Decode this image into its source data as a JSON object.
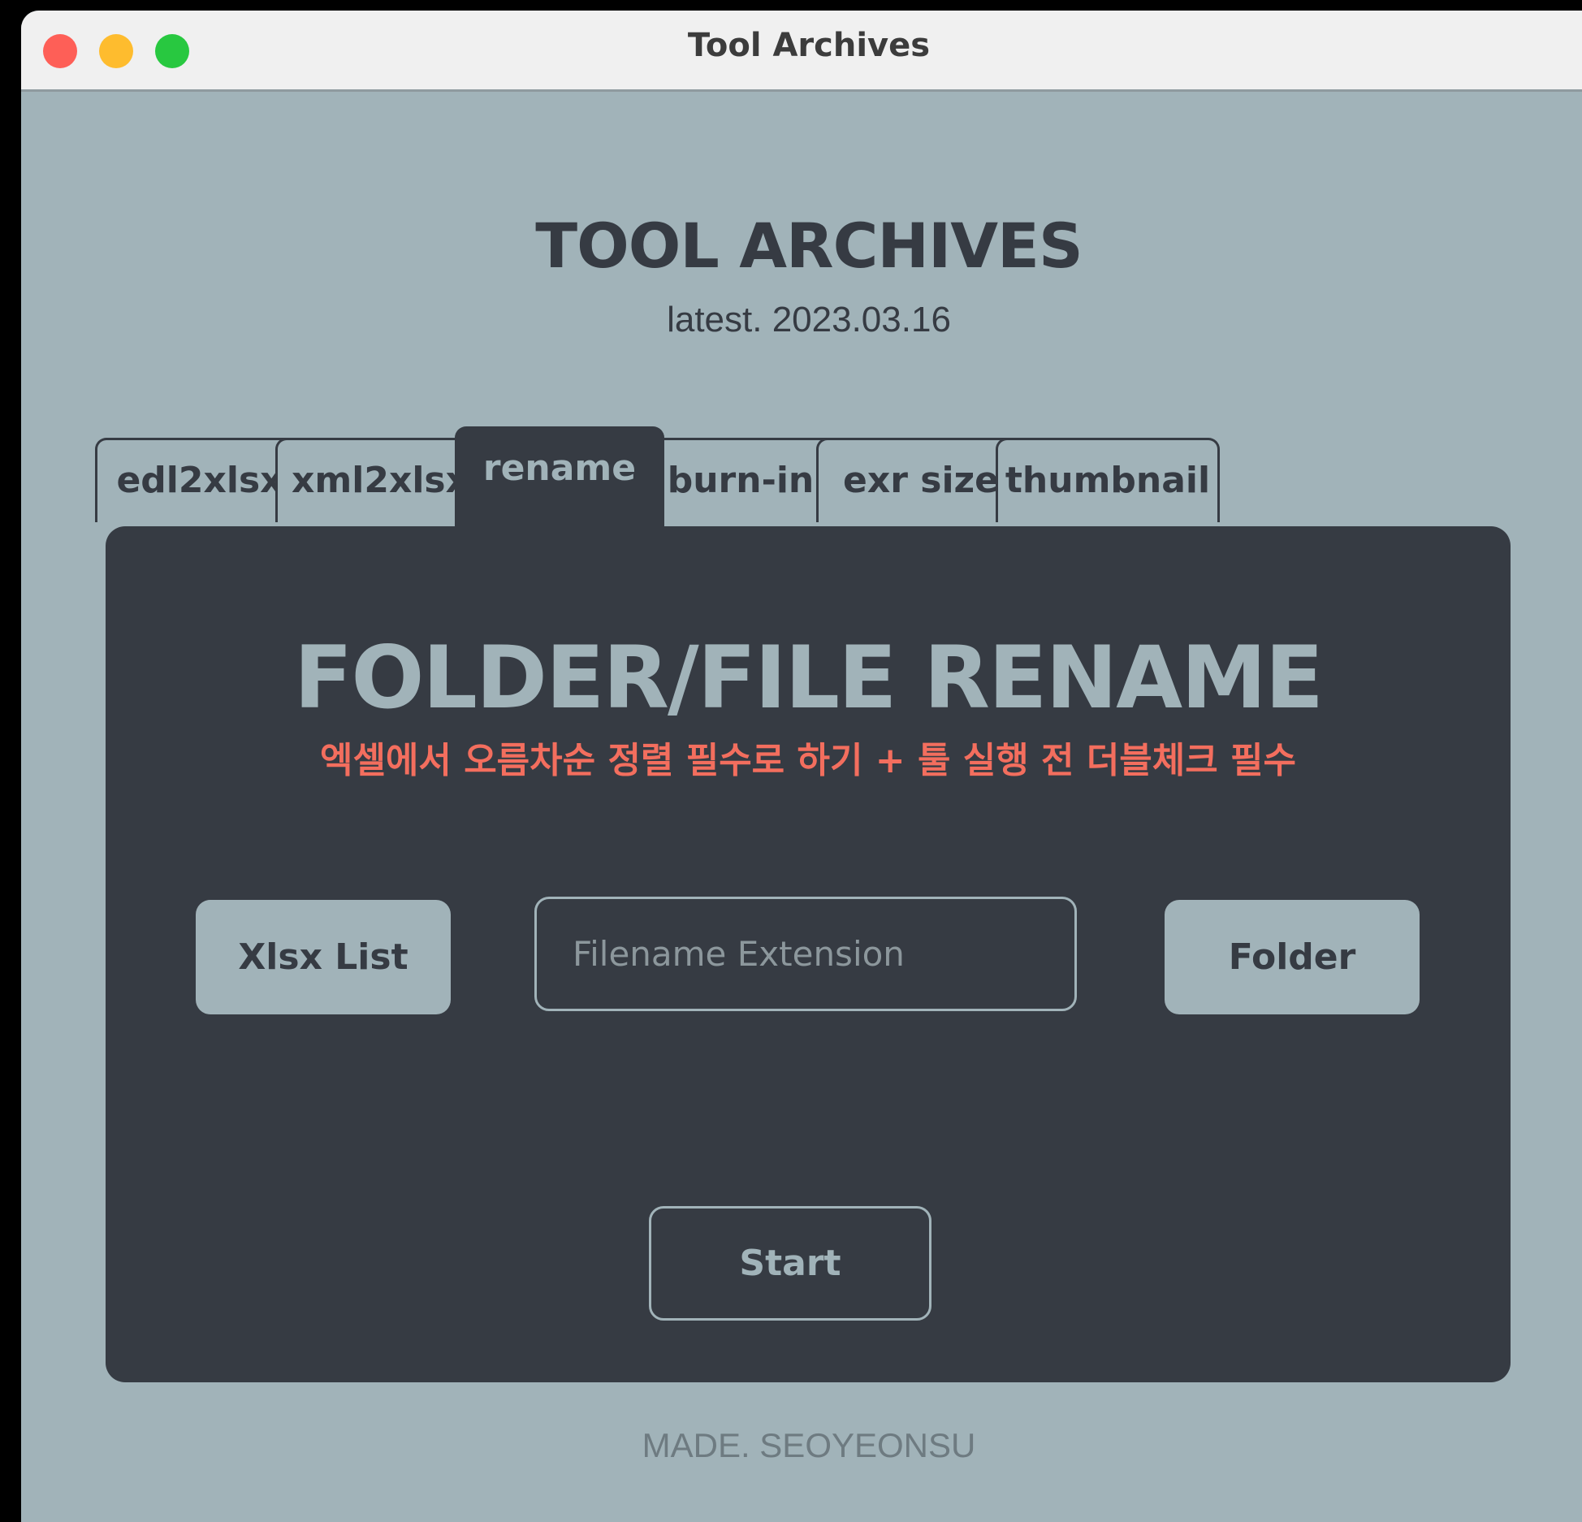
{
  "window": {
    "title": "Tool Archives"
  },
  "header": {
    "title": "TOOL ARCHIVES",
    "subtitle": "latest. 2023.03.16"
  },
  "tabs": [
    {
      "label": "edl2xlsx",
      "active": false
    },
    {
      "label": "xml2xlsx",
      "active": false
    },
    {
      "label": "rename",
      "active": true
    },
    {
      "label": "burn-in",
      "active": false
    },
    {
      "label": "exr size",
      "active": false
    },
    {
      "label": "thumbnail",
      "active": false
    }
  ],
  "panel": {
    "title": "FOLDER/FILE RENAME",
    "note": "엑셀에서 오름차순 정렬 필수로 하기 + 툴 실행 전 더블체크 필수",
    "xlsx_button": "Xlsx List",
    "extension_input": {
      "value": "",
      "placeholder": "Filename Extension"
    },
    "folder_button": "Folder",
    "start_button": "Start"
  },
  "footer": {
    "text": "MADE. SEOYEONSU"
  },
  "colors": {
    "background": "#a1b3b9",
    "panel": "#363b43",
    "warning": "#f36e5e"
  }
}
